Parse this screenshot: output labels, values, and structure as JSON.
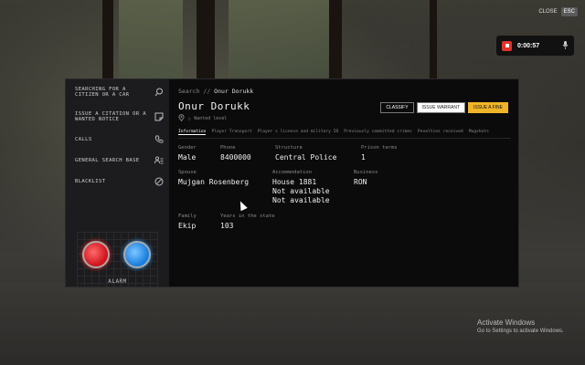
{
  "window": {
    "close_label": "CLOSE",
    "close_key": "ESC"
  },
  "call": {
    "timer": "0:00:57",
    "record_icon": "stop-icon",
    "mic_icon": "mic-icon"
  },
  "sidebar": {
    "items": [
      {
        "label": "SEARCHING FOR A CITIZEN OR A CAR",
        "icon": "search-icon"
      },
      {
        "label": "ISSUE A CITATION OR A WANTED NOTICE",
        "icon": "note-icon"
      },
      {
        "label": "CALLS",
        "icon": "phone-icon"
      },
      {
        "label": "GENERAL SEARCH BASE",
        "icon": "people-list-icon"
      },
      {
        "label": "BLACKLIST",
        "icon": "blocked-icon"
      }
    ],
    "alarm_label": "ALARM"
  },
  "main": {
    "breadcrumb": {
      "root": "Search",
      "separator": "//",
      "current": "Onur Dorukk"
    },
    "name": "Onur Dorukk",
    "wanted_level_label": "Wanted level",
    "actions": {
      "classify": "CLASSIFY",
      "warrant": "ISSUE WARRANT",
      "fine": "ISSUE A FINE"
    },
    "tabs": [
      "Information",
      "Player Transport",
      "Player s license and military ID",
      "Previously committed crimes",
      "Penalties received",
      "Mugshots"
    ],
    "fields": {
      "gender": {
        "label": "Gender",
        "value": "Male"
      },
      "phone": {
        "label": "Phone",
        "value": "8400000"
      },
      "structure": {
        "label": "Structure",
        "value": "Central Police"
      },
      "prison_terms": {
        "label": "Prison terms",
        "value": "1"
      },
      "spouse": {
        "label": "Spouse",
        "value": "Mujgan Rosenberg"
      },
      "accommodation": {
        "label": "Accommodation",
        "value1": "House 1881",
        "value2": "Not available",
        "value3": "Not available"
      },
      "business": {
        "label": "Business",
        "value": "RON"
      },
      "family": {
        "label": "Family",
        "value": "Ekip"
      },
      "years": {
        "label": "Years in the state",
        "value": "103"
      }
    }
  },
  "os_watermark": {
    "title": "Activate Windows",
    "subtitle": "Go to Settings to activate Windows."
  }
}
